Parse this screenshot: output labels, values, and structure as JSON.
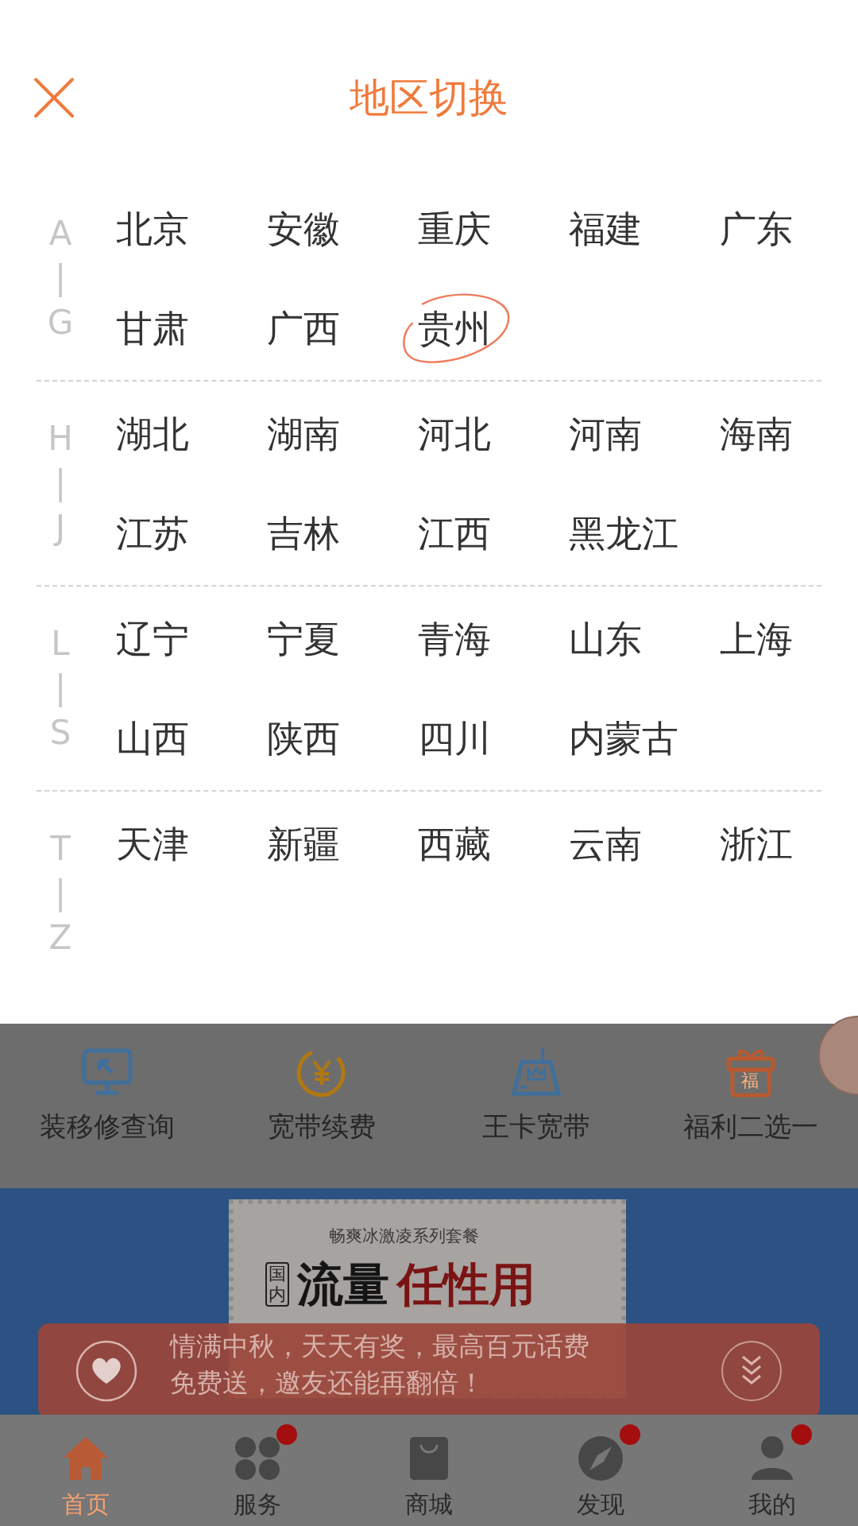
{
  "header": {
    "title": "地区切换"
  },
  "groups": [
    {
      "letters": [
        "A",
        "|",
        "G"
      ],
      "cities": [
        {
          "name": "北京",
          "circled": false
        },
        {
          "name": "安徽",
          "circled": false
        },
        {
          "name": "重庆",
          "circled": false
        },
        {
          "name": "福建",
          "circled": false
        },
        {
          "name": "广东",
          "circled": false
        },
        {
          "name": "甘肃",
          "circled": false
        },
        {
          "name": "广西",
          "circled": false
        },
        {
          "name": "贵州",
          "circled": true
        }
      ]
    },
    {
      "letters": [
        "H",
        "|",
        "J"
      ],
      "cities": [
        {
          "name": "湖北",
          "circled": false
        },
        {
          "name": "湖南",
          "circled": false
        },
        {
          "name": "河北",
          "circled": false
        },
        {
          "name": "河南",
          "circled": false
        },
        {
          "name": "海南",
          "circled": false
        },
        {
          "name": "江苏",
          "circled": false
        },
        {
          "name": "吉林",
          "circled": false
        },
        {
          "name": "江西",
          "circled": false
        },
        {
          "name": "黑龙江",
          "circled": false
        }
      ]
    },
    {
      "letters": [
        "L",
        "|",
        "S"
      ],
      "cities": [
        {
          "name": "辽宁",
          "circled": false
        },
        {
          "name": "宁夏",
          "circled": false
        },
        {
          "name": "青海",
          "circled": false
        },
        {
          "name": "山东",
          "circled": false
        },
        {
          "name": "上海",
          "circled": false
        },
        {
          "name": "山西",
          "circled": false
        },
        {
          "name": "陕西",
          "circled": false
        },
        {
          "name": "四川",
          "circled": false
        },
        {
          "name": "内蒙古",
          "circled": false
        }
      ]
    },
    {
      "letters": [
        "T",
        "|",
        "Z"
      ],
      "cities": [
        {
          "name": "天津",
          "circled": false
        },
        {
          "name": "新疆",
          "circled": false
        },
        {
          "name": "西藏",
          "circled": false
        },
        {
          "name": "云南",
          "circled": false
        },
        {
          "name": "浙江",
          "circled": false
        }
      ]
    }
  ],
  "shortcuts": [
    {
      "kind": "monitor",
      "label": "装移修查询"
    },
    {
      "kind": "yen",
      "label": "宽带续费"
    },
    {
      "kind": "router",
      "label": "王卡宽带"
    },
    {
      "kind": "gift",
      "label": "福利二选一",
      "icon_text": "福"
    }
  ],
  "banner": {
    "subtitle": "畅爽冰激凌系列套餐",
    "tag": "国内",
    "headline_1": "流量",
    "headline_2": "任性用"
  },
  "notice": {
    "text": "情满中秋，天天有奖，最高百元话费免费送，邀友还能再翻倍！"
  },
  "nav": [
    {
      "kind": "home",
      "label": "首页",
      "selected": true,
      "dot": false
    },
    {
      "kind": "services",
      "label": "服务",
      "selected": false,
      "dot": true
    },
    {
      "kind": "shop",
      "label": "商城",
      "selected": false,
      "dot": false
    },
    {
      "kind": "discover",
      "label": "发现",
      "selected": false,
      "dot": true
    },
    {
      "kind": "profile",
      "label": "我的",
      "selected": false,
      "dot": true
    }
  ]
}
